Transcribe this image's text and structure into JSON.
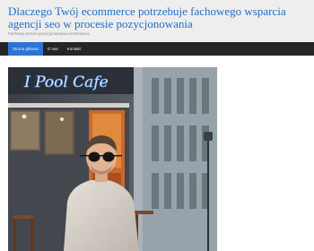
{
  "site": {
    "title": "Dlaczego Twój ecommerce potrzebuje fachowego wsparcia agencji seo w procesie pozycjonowania",
    "description": "Fachowy proces pozycjonowania ecommerce"
  },
  "nav": {
    "items": [
      {
        "label": "Strona główna"
      },
      {
        "label": "O nas"
      },
      {
        "label": "Kontakt"
      }
    ]
  },
  "featured_image": {
    "neon_sign_text": "I Pool Cafe"
  }
}
